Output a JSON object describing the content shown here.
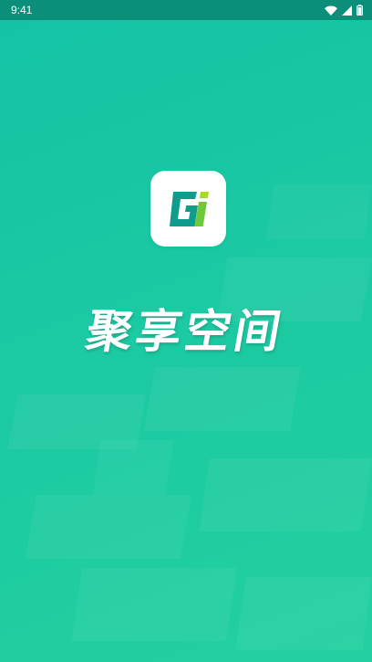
{
  "status_bar": {
    "time": "9:41",
    "icons": [
      "wifi-icon",
      "cellular-signal-icon",
      "battery-icon"
    ]
  },
  "app": {
    "name": "聚享空间",
    "logo_icon": "app-logo-icon",
    "logo_letter": "G"
  },
  "colors": {
    "background_top": "#14c2a6",
    "background_bottom": "#22d09f",
    "status_bar": "#0b8f7b",
    "logo_teal": "#0f9c8c",
    "logo_lime": "#a6dd1e"
  }
}
